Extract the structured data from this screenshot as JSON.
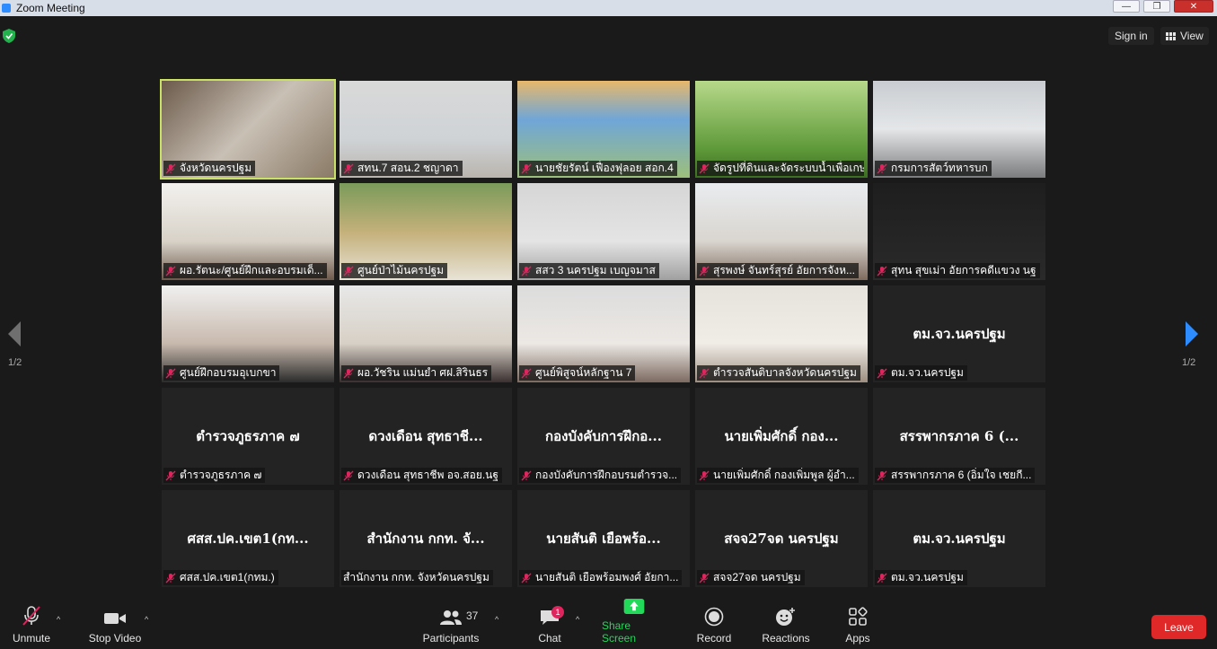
{
  "window": {
    "title": "Zoom Meeting"
  },
  "topbar": {
    "signin_label": "Sign in",
    "view_label": "View"
  },
  "pagination": {
    "left_label": "1/2",
    "right_label": "1/2"
  },
  "tiles": [
    {
      "label": "จังหวัดนครปฐม",
      "type": "video",
      "active": true
    },
    {
      "label": "สทน.7 สอน.2 ชญาดา",
      "type": "video"
    },
    {
      "label": "นายชัยรัตน์ เฟื่องฟุลอย สอก.4",
      "type": "video"
    },
    {
      "label": "จัดรูปที่ดินและจัดระบบน้ำเพื่อเกษ...",
      "type": "video"
    },
    {
      "label": "กรมการสัตว์ทหารบก",
      "type": "video"
    },
    {
      "label": "ผอ.รัตนะ/ศูนย์ฝึกและอบรมเด็...",
      "type": "video"
    },
    {
      "label": "ศูนย์ป่าไม้นครปฐม",
      "type": "video"
    },
    {
      "label": "สสว 3 นครปฐม เบญจมาส",
      "type": "video"
    },
    {
      "label": "สุรพงษ์ จันทร์สุรย์ อัยการจังห...",
      "type": "video"
    },
    {
      "label": "สุทน สุขเม่า อัยการคดีแขวง นฐ",
      "type": "video"
    },
    {
      "label": "ศูนย์ฝึกอบรมอุเบกขา",
      "type": "video"
    },
    {
      "label": "ผอ.วัชริน แม่นยำ ศฝ.สิรินธร",
      "type": "video"
    },
    {
      "label": "ศูนย์พิสูจน์หลักฐาน 7",
      "type": "video"
    },
    {
      "label": "ตำรวจสันติบาลจังหวัดนครปฐม",
      "type": "video"
    },
    {
      "label": "ตม.จว.นครปฐม",
      "center": "ตม.จว.นครปฐม",
      "type": "name"
    },
    {
      "label": "ตำรวจภูธรภาค ๗",
      "center": "ตำรวจภูธรภาค ๗",
      "type": "name"
    },
    {
      "label": "ดวงเดือน สุทธาชีพ อจ.สอย.นฐ",
      "center": "ดวงเดือน สุทธาชี...",
      "type": "name"
    },
    {
      "label": "กองบังคับการฝึกอบรมตำรวจ...",
      "center": "กองบังคับการฝึกอ...",
      "type": "name"
    },
    {
      "label": "นายเพิ่มศักดิ์ กองเพิ่มพูล ผู้อำ...",
      "center": "นายเพิ่มศักดิ์ กอง...",
      "type": "name"
    },
    {
      "label": "สรรพากรภาค 6 (อิ่มใจ เชยกี...",
      "center": "สรรพากรภาค 6 (...",
      "type": "name"
    },
    {
      "label": "ศสส.ปค.เขต1(กทม.)",
      "center": "ศสส.ปค.เขต1(กท...",
      "type": "name"
    },
    {
      "label": "สำนักงาน กกท. จังหวัดนครปฐม",
      "center": "สำนักงาน กกท. จั...",
      "type": "name",
      "unmuted": true
    },
    {
      "label": "นายสันติ เยือพร้อมพงศ์ อัยกา...",
      "center": "นายสันติ เยือพร้อ...",
      "type": "name"
    },
    {
      "label": "สจจ27จด นครปฐม",
      "center": "สจจ27จด นครปฐม",
      "type": "name"
    },
    {
      "label": "ตม.จว.นครปฐม",
      "center": "ตม.จว.นครปฐม",
      "type": "name"
    }
  ],
  "toolbar": {
    "unmute_label": "Unmute",
    "stop_video_label": "Stop Video",
    "participants_label": "Participants",
    "participants_count": "37",
    "chat_label": "Chat",
    "chat_badge": "1",
    "share_label": "Share Screen",
    "record_label": "Record",
    "reactions_label": "Reactions",
    "apps_label": "Apps",
    "leave_label": "Leave"
  },
  "colors": {
    "active_speaker": "#c9e265",
    "share_green": "#23d959",
    "leave_red": "#e02828",
    "mute_red": "#e0245e"
  }
}
